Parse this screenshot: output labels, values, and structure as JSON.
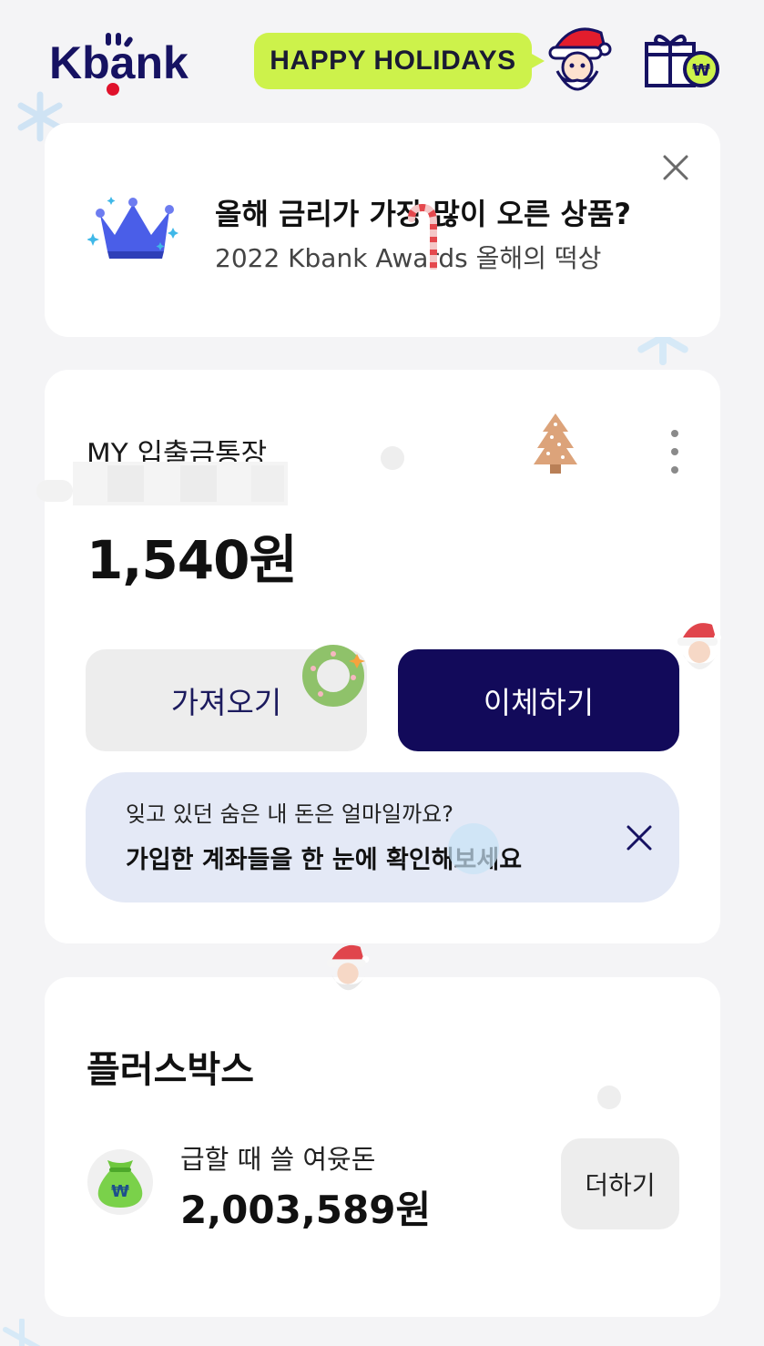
{
  "header": {
    "brand": "Kbank",
    "holiday_banner": "HAPPY HOLIDAYS",
    "icons": [
      "kbank-logo",
      "santa-icon",
      "gift-won-icon"
    ]
  },
  "promo": {
    "title": "올해 금리가 가장 많이 오른 상품?",
    "subtitle": "2022 Kbank Awards 올해의 떡상",
    "icons": [
      "crown-icon",
      "close-icon"
    ]
  },
  "account": {
    "name": "MY 입출금통장",
    "balance": "1,540원",
    "buttons": {
      "fetch": "가져오기",
      "transfer": "이체하기"
    },
    "notice": {
      "line1": "잊고 있던 숨은 내 돈은 얼마일까요?",
      "line2": "가입한 계좌들을 한 눈에 확인해보세요"
    },
    "icons": [
      "more-vertical-icon",
      "close-icon"
    ]
  },
  "plusbox": {
    "title": "플러스박스",
    "item_label": "급할 때 쓸 여윳돈",
    "item_amount": "2,003,589원",
    "add_button": "더하기",
    "icons": [
      "money-bag-icon"
    ]
  },
  "colors": {
    "brand_navy": "#120a5a",
    "holiday_lime": "#cdf24b",
    "notice_bg": "#e4e9f6",
    "logo_red": "#e0122c"
  }
}
